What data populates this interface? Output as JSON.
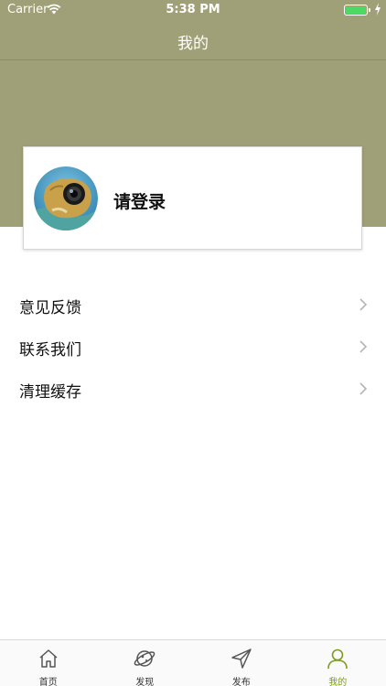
{
  "status_bar": {
    "carrier": "Carrier",
    "time": "5:38 PM",
    "battery_level": 1.0
  },
  "nav": {
    "title": "我的"
  },
  "profile": {
    "login_label": "请登录"
  },
  "menu": [
    {
      "label": "意见反馈",
      "icon": "chevron-right-icon"
    },
    {
      "label": "联系我们",
      "icon": "chevron-right-icon"
    },
    {
      "label": "清理缓存",
      "icon": "chevron-right-icon"
    }
  ],
  "tabs": [
    {
      "label": "首页",
      "icon": "home-icon",
      "active": false
    },
    {
      "label": "发现",
      "icon": "planet-icon",
      "active": false
    },
    {
      "label": "发布",
      "icon": "send-arrow-icon",
      "active": false
    },
    {
      "label": "我的",
      "icon": "user-icon",
      "active": true
    }
  ],
  "colors": {
    "header_bg": "#9fa077",
    "active_tab": "#7d9a23",
    "battery": "#4cd964"
  }
}
